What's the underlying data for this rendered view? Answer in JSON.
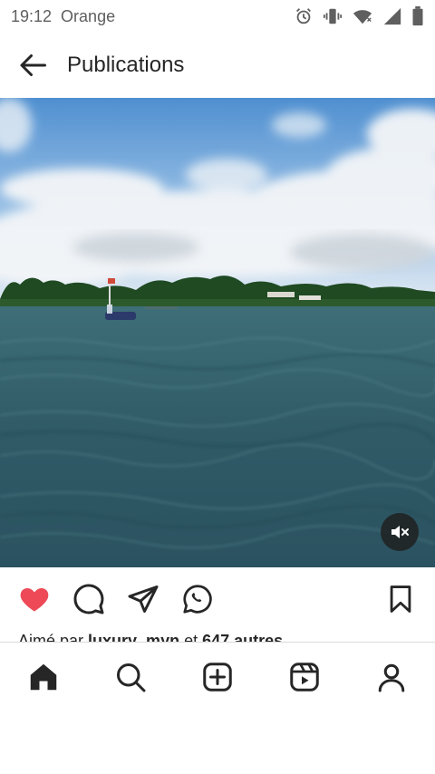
{
  "status_bar": {
    "time": "19:12",
    "carrier": "Orange",
    "icons": [
      "alarm-icon",
      "vibrate-icon",
      "wifi-icon",
      "signal-icon",
      "battery-icon"
    ]
  },
  "header": {
    "title": "Publications",
    "back_icon": "arrow-left-icon"
  },
  "post": {
    "media_type": "video",
    "muted": true,
    "actions": [
      "heart-icon",
      "comment-icon",
      "share-icon",
      "whatsapp-icon",
      "bookmark-icon"
    ],
    "liked": true,
    "likes_prefix": "Aimé par ",
    "likes_user": "luxury_myn",
    "likes_mid": " et ",
    "likes_count": "647 autres"
  },
  "bottom_nav": {
    "items": [
      "home-icon",
      "search-icon",
      "new-post-icon",
      "reels-icon",
      "profile-icon"
    ],
    "active": "home"
  },
  "colors": {
    "like_red": "#ed4956",
    "text": "#262626",
    "status_gray": "#5f5f5f"
  }
}
